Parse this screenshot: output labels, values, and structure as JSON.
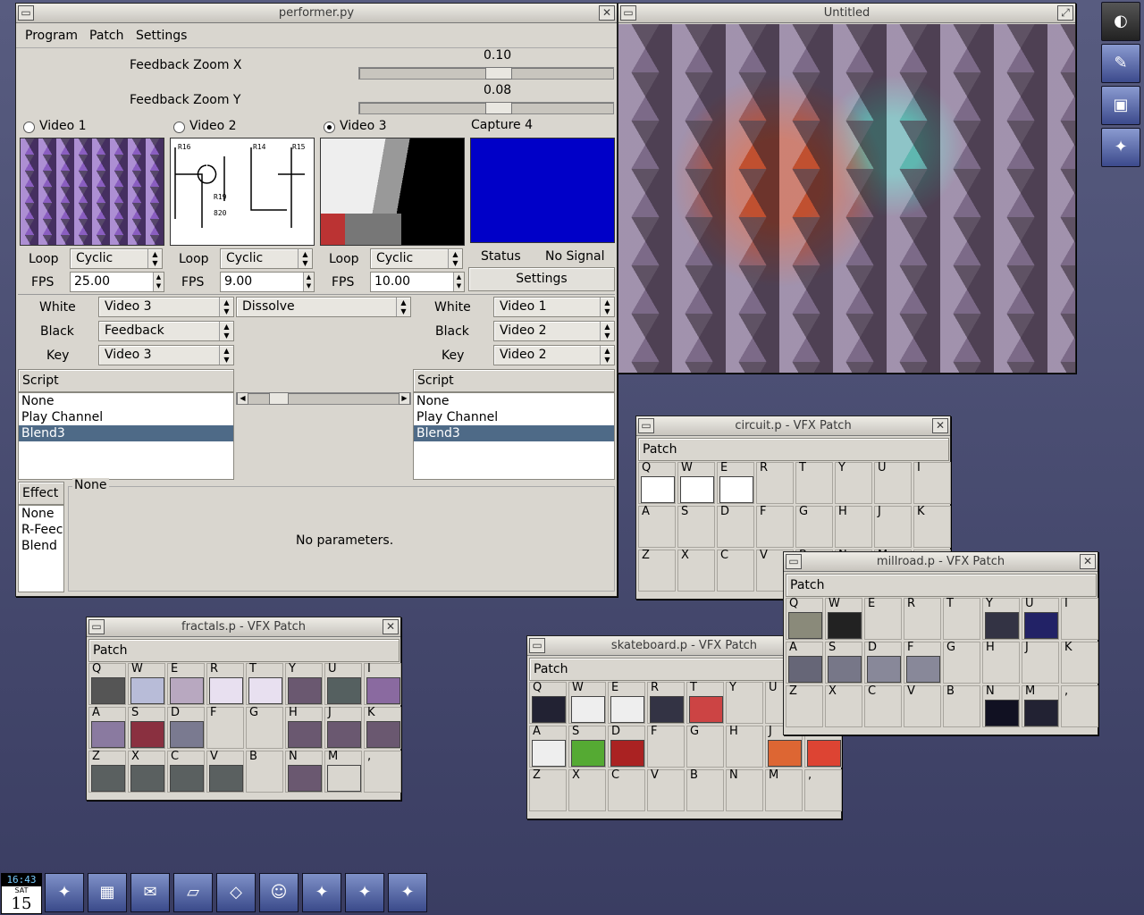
{
  "performer": {
    "title": "performer.py",
    "menu": [
      "Program",
      "Patch",
      "Settings"
    ],
    "zoom_x": {
      "label": "Feedback Zoom X",
      "value": "0.10",
      "level": 0.55
    },
    "zoom_y": {
      "label": "Feedback Zoom Y",
      "value": "0.08",
      "level": 0.55
    },
    "sources": [
      {
        "label": "Video 1",
        "selected": false
      },
      {
        "label": "Video 2",
        "selected": false
      },
      {
        "label": "Video 3",
        "selected": true
      }
    ],
    "capture": {
      "label": "Capture 4",
      "status_label": "Status",
      "status_value": "No Signal",
      "settings_label": "Settings",
      "color": "#0000c8"
    },
    "loop_label": "Loop",
    "fps_label": "FPS",
    "video_controls": [
      {
        "loop": "Cyclic",
        "fps": "25.00"
      },
      {
        "loop": "Cyclic",
        "fps": "9.00"
      },
      {
        "loop": "Cyclic",
        "fps": "10.00"
      }
    ],
    "mix_left": {
      "white_label": "White",
      "white": "Video 3",
      "black_label": "Black",
      "black": "Feedback",
      "key_label": "Key",
      "key": "Video 3"
    },
    "transition": "Dissolve",
    "mix_right": {
      "white_label": "White",
      "white": "Video 1",
      "black_label": "Black",
      "black": "Video 2",
      "key_label": "Key",
      "key": "Video 2"
    },
    "script_header": "Script",
    "script_items": [
      "None",
      "Play Channel",
      "Blend3"
    ],
    "effect_header": "Effect",
    "effect_items": [
      "None",
      "R-Feec",
      "Blend"
    ],
    "params_group": "None",
    "params_text": "No parameters."
  },
  "output": {
    "title": "Untitled"
  },
  "circuit": {
    "title": "circuit.p - VFX Patch",
    "patch_label": "Patch"
  },
  "millroad": {
    "title": "millroad.p - VFX Patch",
    "patch_label": "Patch"
  },
  "fractals": {
    "title": "fractals.p - VFX Patch",
    "patch_label": "Patch"
  },
  "skateboard": {
    "title": "skateboard.p - VFX Patch",
    "patch_label": "Patch"
  },
  "keys": {
    "row1": [
      "Q",
      "W",
      "E",
      "R",
      "T",
      "Y",
      "U",
      "I"
    ],
    "row2": [
      "A",
      "S",
      "D",
      "F",
      "G",
      "H",
      "J",
      "K"
    ],
    "row3": [
      "Z",
      "X",
      "C",
      "V",
      "B",
      "N",
      "M",
      ","
    ]
  },
  "clock": {
    "time": "16:43",
    "day": "SAT",
    "date": "15"
  }
}
